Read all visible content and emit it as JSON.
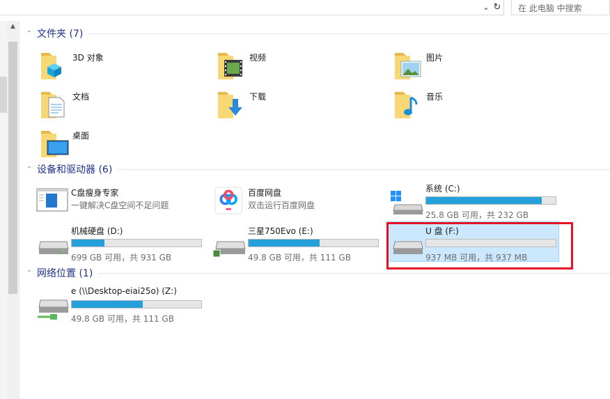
{
  "search": {
    "placeholder": "在 此电脑 中搜索"
  },
  "groups": {
    "folders": {
      "title": "文件夹 (7)"
    },
    "devices": {
      "title": "设备和驱动器 (6)"
    },
    "network": {
      "title": "网络位置 (1)"
    }
  },
  "folders": [
    {
      "name": "3D 对象",
      "icon": "3d-objects-folder-icon"
    },
    {
      "name": "视频",
      "icon": "videos-folder-icon"
    },
    {
      "name": "图片",
      "icon": "pictures-folder-icon"
    },
    {
      "name": "文档",
      "icon": "documents-folder-icon"
    },
    {
      "name": "下载",
      "icon": "downloads-folder-icon"
    },
    {
      "name": "音乐",
      "icon": "music-folder-icon"
    },
    {
      "name": "桌面",
      "icon": "desktop-folder-icon"
    }
  ],
  "apps": [
    {
      "name": "C盘瘦身专家",
      "sub": "一键解决C盘空间不足问题"
    },
    {
      "name": "百度网盘",
      "sub": "双击运行百度网盘"
    }
  ],
  "drives": [
    {
      "name": "系统 (C:)",
      "info": "25.8 GB 可用，共 232 GB",
      "used_fraction": 0.89
    },
    {
      "name": "机械硬盘 (D:)",
      "info": "699 GB 可用，共 931 GB",
      "used_fraction": 0.25
    },
    {
      "name": "三星750Evo (E:)",
      "info": "49.8 GB 可用，共 111 GB",
      "used_fraction": 0.55
    },
    {
      "name": "U 盘 (F:)",
      "info": "937 MB 可用，共 937 MB",
      "used_fraction": 0.0
    }
  ],
  "network_drives": [
    {
      "name": "e (\\\\Desktop-eiai25o) (Z:)",
      "info": "49.8 GB 可用，共 111 GB",
      "used_fraction": 0.55
    }
  ],
  "colors": {
    "accent": "#26a0da",
    "highlight": "#e81123",
    "selection": "#cce8ff"
  }
}
